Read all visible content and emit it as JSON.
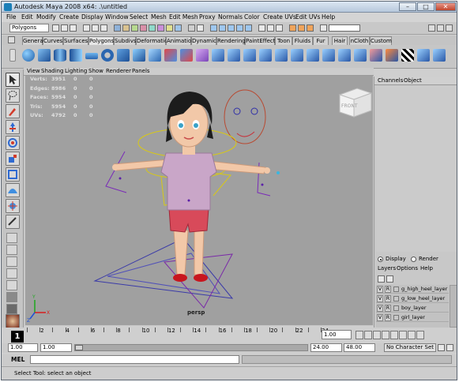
{
  "window": {
    "title": "Autodesk Maya 2008 x64: .\\untitled",
    "min": "–",
    "max": "□",
    "close": "✕"
  },
  "menubar": [
    "File",
    "Edit",
    "Modify",
    "Create",
    "Display",
    "Window",
    "Select",
    "Mesh",
    "Edit Mesh",
    "Proxy",
    "Normals",
    "Color",
    "Create UVs",
    "Edit UVs",
    "Help"
  ],
  "status_line": {
    "mode": "Polygons"
  },
  "shelf_tabs": [
    "General",
    "Curves",
    "Surfaces",
    "Polygons",
    "Subdivs",
    "Deformation",
    "Animation",
    "Dynamics",
    "Rendering",
    "PaintEffects",
    "Toon",
    "Fluids",
    "Fur",
    "Hair",
    "nCloth",
    "Custom"
  ],
  "shelf_active_tab": "Polygons",
  "viewport_menu": [
    "View",
    "Shading",
    "Lighting",
    "Show",
    "Renderer",
    "Panels"
  ],
  "hud": [
    {
      "label": "Verts:",
      "values": [
        "3951",
        "0",
        "0"
      ]
    },
    {
      "label": "Edges:",
      "values": [
        "8986",
        "0",
        "0"
      ]
    },
    {
      "label": "Faces:",
      "values": [
        "5954",
        "0",
        "0"
      ]
    },
    {
      "label": "Tris:",
      "values": [
        "5954",
        "0",
        "0"
      ]
    },
    {
      "label": "UVs:",
      "values": [
        "4792",
        "0",
        "0"
      ]
    }
  ],
  "viewcube_label": "FRONT",
  "camera_name": "persp",
  "axis_labels": {
    "x": "X",
    "y": "Y",
    "z": "Z"
  },
  "channel_box": {
    "menu": [
      "Channels",
      "Object"
    ]
  },
  "layer_editor": {
    "display_label": "Display",
    "render_label": "Render",
    "menu": [
      "Layers",
      "Options",
      "Help"
    ],
    "layers": [
      {
        "name": "g_high_heel_layer"
      },
      {
        "name": "g_low_heel_layer"
      },
      {
        "name": "boy_layer"
      },
      {
        "name": "girl_layer"
      }
    ],
    "v": "V",
    "r": "R"
  },
  "timeslider": {
    "current_frame": "1",
    "tick_labels": [
      "2",
      "4",
      "6",
      "8",
      "10",
      "12",
      "14",
      "16",
      "18",
      "20",
      "22",
      "24"
    ],
    "current_field": "1.00"
  },
  "range": {
    "start": "1.00",
    "playback_start": "1.00",
    "playback_end": "24.00",
    "end": "48.00",
    "character_set": "No Character Set"
  },
  "command": {
    "label": "MEL"
  },
  "help_line": "Select Tool: select an object",
  "colors": {
    "viewport_bg": "#a0a0a0",
    "ui_bg": "#cfcfcf",
    "title_bg": "#c9d7e8",
    "skirt": "#c8a6c8",
    "skin": "#f1c8a8"
  }
}
